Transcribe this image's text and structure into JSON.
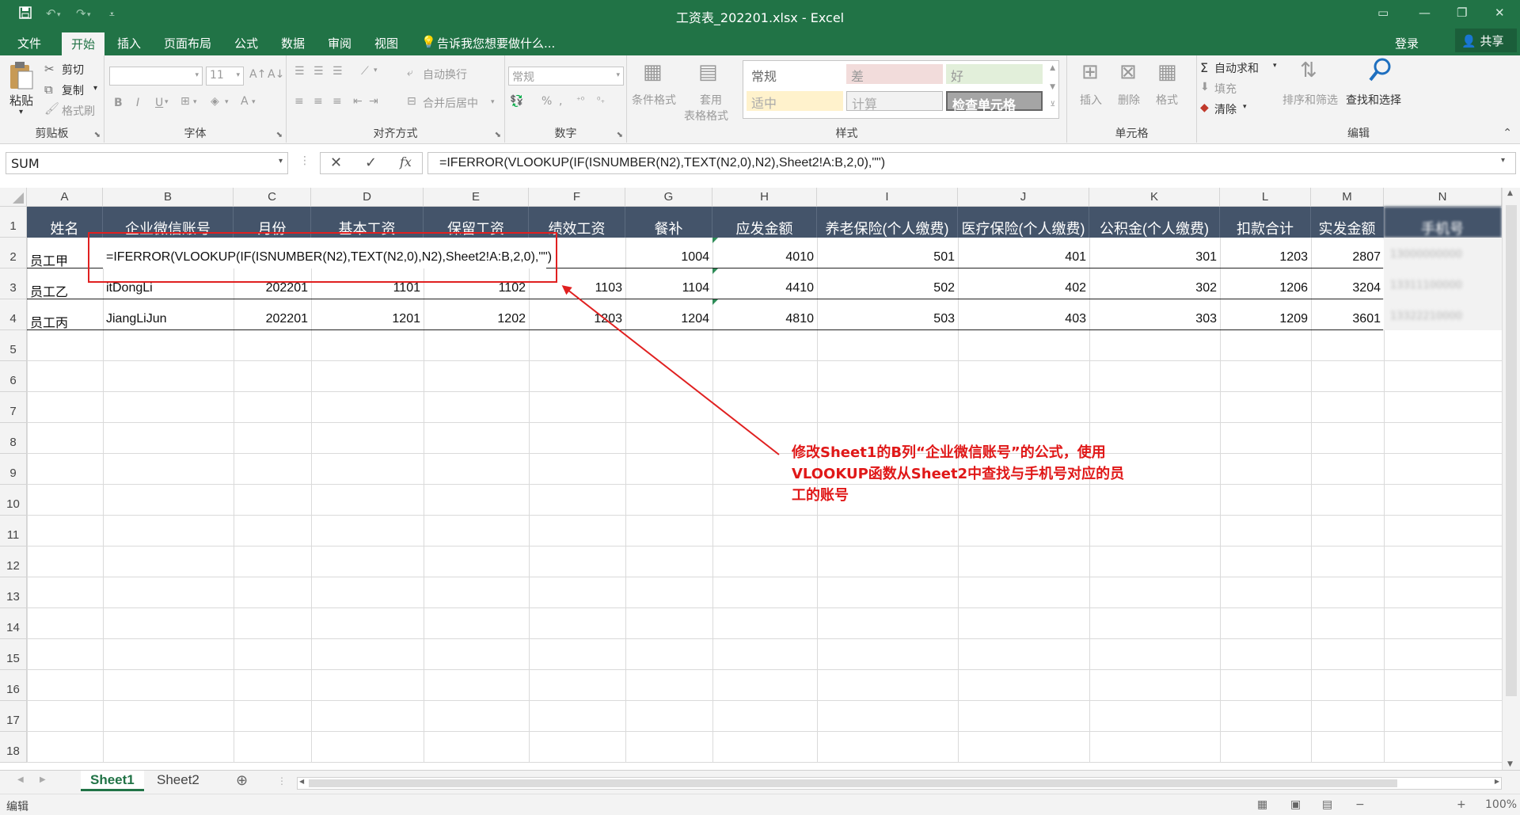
{
  "titlebar": {
    "title": "工资表_202201.xlsx - Excel",
    "save_icon": "save-icon",
    "undo_icon": "undo-icon",
    "redo_icon": "redo-icon"
  },
  "menu": {
    "tabs": [
      "文件",
      "开始",
      "插入",
      "页面布局",
      "公式",
      "数据",
      "审阅",
      "视图"
    ],
    "active_tab": "开始",
    "tell_me": "告诉我您想要做什么...",
    "login": "登录",
    "share": "共享"
  },
  "ribbon": {
    "clipboard": {
      "paste": "粘贴",
      "cut": "剪切",
      "copy": "复制",
      "format_painter": "格式刷",
      "label": "剪贴板"
    },
    "font": {
      "size": "11",
      "bold": "B",
      "italic": "I",
      "underline": "U",
      "label": "字体"
    },
    "alignment": {
      "wrap": "自动换行",
      "merge": "合并后居中",
      "label": "对齐方式"
    },
    "number": {
      "format": "常规",
      "percent": "%",
      "label": "数字"
    },
    "styles": {
      "conditional": "条件格式",
      "table_format_1": "套用",
      "table_format_2": "表格格式",
      "cells": [
        "常规",
        "差",
        "好",
        "适中",
        "计算",
        "检查单元格"
      ],
      "label": "样式"
    },
    "cells": {
      "insert": "插入",
      "delete": "删除",
      "format": "格式",
      "label": "单元格"
    },
    "editing": {
      "autosum": "自动求和",
      "fill": "填充",
      "clear": "清除",
      "sort": "排序和筛选",
      "find": "查找和选择",
      "label": "编辑"
    }
  },
  "formula_bar": {
    "name_box": "SUM",
    "cancel": "✕",
    "enter": "✓",
    "fx": "fx",
    "formula": "=IFERROR(VLOOKUP(IF(ISNUMBER(N2),TEXT(N2,0),N2),Sheet2!A:B,2,0),\"\")"
  },
  "sheet": {
    "columns": [
      "A",
      "B",
      "C",
      "D",
      "E",
      "F",
      "G",
      "H",
      "I",
      "J",
      "K",
      "L",
      "M",
      "N"
    ],
    "row_numbers": [
      "1",
      "2",
      "3",
      "4",
      "5",
      "6",
      "7",
      "8",
      "9",
      "10",
      "11",
      "12",
      "13",
      "14",
      "15",
      "16",
      "17",
      "18"
    ],
    "header": [
      "姓名",
      "企业微信账号",
      "月份",
      "基本工资",
      "保留工资",
      "绩效工资",
      "餐补",
      "应发金额",
      "养老保险(个人缴费)",
      "医疗保险(个人缴费)",
      "公积金(个人缴费)",
      "扣款合计",
      "实发金额",
      "手机号"
    ],
    "editing_formula": "=IFERROR(VLOOKUP(IF(ISNUMBER(N2),TEXT(N2,0),N2),Sheet2!A:B,2,0),\"\")",
    "rows": [
      {
        "A": "员工甲",
        "B": "",
        "C": "",
        "D": "",
        "E": "",
        "F": "",
        "G": "1004",
        "H": "4010",
        "I": "501",
        "J": "401",
        "K": "301",
        "L": "1203",
        "M": "2807",
        "N": "13000000000"
      },
      {
        "A": "员工乙",
        "B": "itDongLi",
        "C": "202201",
        "D": "1101",
        "E": "1102",
        "F": "1103",
        "G": "1104",
        "H": "4410",
        "I": "502",
        "J": "402",
        "K": "302",
        "L": "1206",
        "M": "3204",
        "N": "13311100000"
      },
      {
        "A": "员工丙",
        "B": "JiangLiJun",
        "C": "202201",
        "D": "1201",
        "E": "1202",
        "F": "1203",
        "G": "1204",
        "H": "4810",
        "I": "503",
        "J": "403",
        "K": "303",
        "L": "1209",
        "M": "3601",
        "N": "13322210000"
      }
    ]
  },
  "annotation": {
    "lines": [
      "修改Sheet1的B列“企业微信账号”的公式，使用",
      "VLOOKUP函数从Sheet2中查找与手机号对应的员",
      "工的账号"
    ],
    "color": "#e02020"
  },
  "sheet_tabs": [
    "Sheet1",
    "Sheet2"
  ],
  "active_sheet": "Sheet1",
  "status": {
    "mode": "编辑",
    "zoom": "100%"
  },
  "colors": {
    "excel_green": "#217346",
    "header_fill": "#44546a"
  }
}
